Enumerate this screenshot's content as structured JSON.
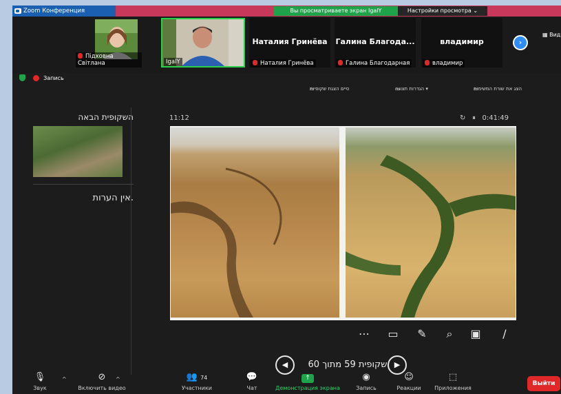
{
  "window": {
    "title": "Zoom Конференция",
    "share_banner": "Вы просматриваете экран IgalY",
    "view_options": "Настройки просмотра ⌄",
    "view_side": "Вид"
  },
  "gallery": {
    "tiles": [
      {
        "label": "Підховна Світлана"
      },
      {
        "label": "IgalY"
      },
      {
        "name": "Наталия Гринёва",
        "label": "Наталия Гринёва"
      },
      {
        "name": "Галина  Благода...",
        "label": "Галина Благодарная"
      },
      {
        "name": "владимир",
        "label": "владимир"
      }
    ]
  },
  "record_label": "Запись",
  "ppt_toolbar": {
    "show_taskbar": "הצג את שורת המשימות",
    "display_settings": "הגדרות תצוגה ▾",
    "end_show": "סיים הצגת שקופיות"
  },
  "presenter": {
    "next_slide_heading": "השקופית הבאה",
    "notes": "אין הערות.",
    "clock": "11:12",
    "timer": "0:41:49",
    "slide_counter": "שקופית 59 מתוך 60"
  },
  "toolbar": {
    "audio": "Звук",
    "video": "Включить видео",
    "participants": "Участники",
    "participants_count": "74",
    "chat": "Чат",
    "share": "Демонстрация экрана",
    "record": "Запись",
    "reactions": "Реакции",
    "apps": "Приложения",
    "leave": "Выйти"
  },
  "colors": {
    "accent": "#2d8cff",
    "share_green": "#1fa34a",
    "danger": "#e02828",
    "titlebar": "#c8385a"
  }
}
